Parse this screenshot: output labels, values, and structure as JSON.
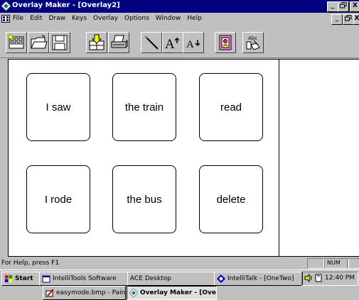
{
  "window": {
    "title": "Overlay Maker - [Overlay2]",
    "caption_minimize": "_",
    "caption_maximize": "×",
    "caption_close": "X"
  },
  "menubar": {
    "items": [
      "File",
      "Edit",
      "Draw",
      "Keys",
      "Overlay",
      "Options",
      "Window",
      "Help"
    ]
  },
  "toolbar": {
    "tools": [
      "new-overlay",
      "open-file",
      "save",
      "import",
      "print",
      "magic-wand",
      "font-larger",
      "font-smaller",
      "picture",
      "spell-check"
    ],
    "font_larger_label": "A",
    "font_smaller_label": "A",
    "abc_label": "Abc"
  },
  "overlay": {
    "keys": [
      {
        "label": "I saw"
      },
      {
        "label": "the train"
      },
      {
        "label": "read"
      },
      {
        "label": "I rode"
      },
      {
        "label": "the bus"
      },
      {
        "label": "delete"
      }
    ]
  },
  "statusbar": {
    "help_text": "For Help, press F1",
    "num_indicator": "NUM"
  },
  "taskbar": {
    "start_label": "Start",
    "buttons": [
      {
        "label": "IntelliTools Software",
        "active": false
      },
      {
        "label": "ACE Desktop",
        "active": false
      },
      {
        "label": "IntelliTalk - [OneTwo]",
        "active": false
      },
      {
        "label": "easymode.bmp - Paint",
        "active": false
      },
      {
        "label": "Overlay Maker - [Over...",
        "active": true
      }
    ],
    "clock": "12:40 PM"
  },
  "colors": {
    "title_bar": "#000080",
    "desktop_face": "#c0c0c0",
    "canvas": "#ffffff"
  }
}
